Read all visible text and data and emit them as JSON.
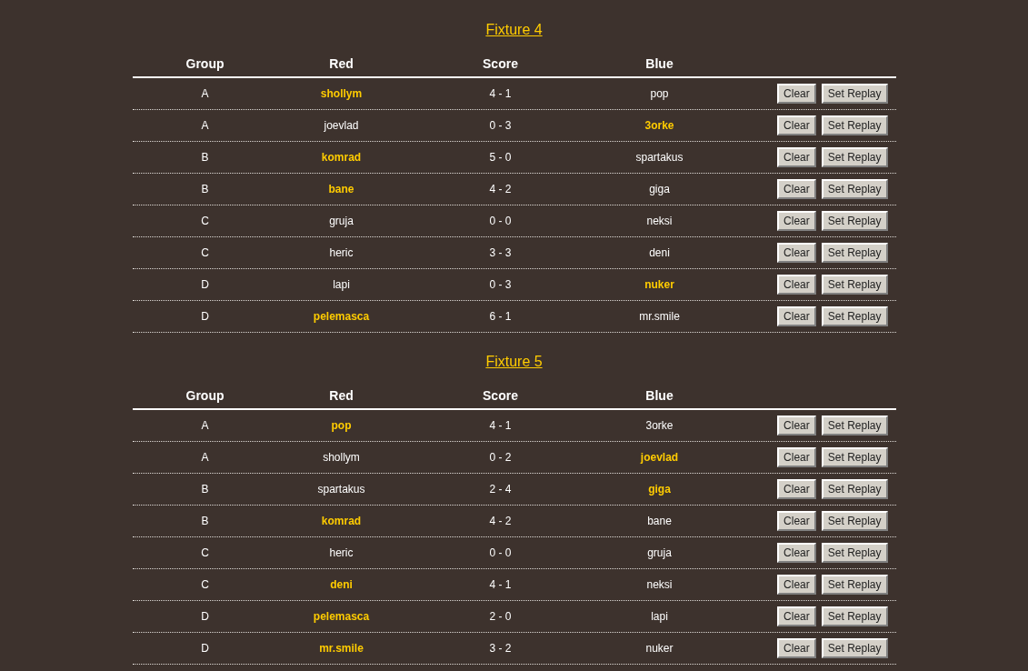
{
  "fixtures": [
    {
      "title": "Fixture 4",
      "columns": [
        "Group",
        "Red",
        "Score",
        "Blue"
      ],
      "rows": [
        {
          "group": "A",
          "red": "shollym",
          "red_highlighted": true,
          "score": "4 - 1",
          "blue": "pop",
          "blue_highlighted": false,
          "buttons": [
            "Clear",
            "Set Replay"
          ]
        },
        {
          "group": "A",
          "red": "joevlad",
          "red_highlighted": false,
          "score": "0 - 3",
          "blue": "3orke",
          "blue_highlighted": true,
          "buttons": [
            "Clear",
            "Set Replay"
          ]
        },
        {
          "group": "B",
          "red": "komrad",
          "red_highlighted": true,
          "score": "5 - 0",
          "blue": "spartakus",
          "blue_highlighted": false,
          "buttons": [
            "Clear",
            "Set Replay"
          ]
        },
        {
          "group": "B",
          "red": "bane",
          "red_highlighted": true,
          "score": "4 - 2",
          "blue": "giga",
          "blue_highlighted": false,
          "buttons": [
            "Clear",
            "Set Replay"
          ]
        },
        {
          "group": "C",
          "red": "gruja",
          "red_highlighted": false,
          "score": "0 - 0",
          "blue": "neksi",
          "blue_highlighted": false,
          "buttons": [
            "Clear",
            "Set Replay"
          ]
        },
        {
          "group": "C",
          "red": "heric",
          "red_highlighted": false,
          "score": "3 - 3",
          "blue": "deni",
          "blue_highlighted": false,
          "buttons": [
            "Clear",
            "Set Replay"
          ]
        },
        {
          "group": "D",
          "red": "lapi",
          "red_highlighted": false,
          "score": "0 - 3",
          "blue": "nuker",
          "blue_highlighted": true,
          "buttons": [
            "Clear",
            "Set Replay"
          ]
        },
        {
          "group": "D",
          "red": "pelemasca",
          "red_highlighted": true,
          "score": "6 - 1",
          "blue": "mr.smile",
          "blue_highlighted": false,
          "buttons": [
            "Clear",
            "Set Replay"
          ]
        }
      ]
    },
    {
      "title": "Fixture 5",
      "columns": [
        "Group",
        "Red",
        "Score",
        "Blue"
      ],
      "rows": [
        {
          "group": "A",
          "red": "pop",
          "red_highlighted": true,
          "score": "4 - 1",
          "blue": "3orke",
          "blue_highlighted": false,
          "buttons": [
            "Clear",
            "Set Replay"
          ]
        },
        {
          "group": "A",
          "red": "shollym",
          "red_highlighted": false,
          "score": "0 - 2",
          "blue": "joevlad",
          "blue_highlighted": true,
          "buttons": [
            "Clear",
            "Set Replay"
          ]
        },
        {
          "group": "B",
          "red": "spartakus",
          "red_highlighted": false,
          "score": "2 - 4",
          "blue": "giga",
          "blue_highlighted": true,
          "buttons": [
            "Clear",
            "Set Replay"
          ]
        },
        {
          "group": "B",
          "red": "komrad",
          "red_highlighted": true,
          "score": "4 - 2",
          "blue": "bane",
          "blue_highlighted": false,
          "buttons": [
            "Clear",
            "Set Replay"
          ]
        },
        {
          "group": "C",
          "red": "heric",
          "red_highlighted": false,
          "score": "0 - 0",
          "blue": "gruja",
          "blue_highlighted": false,
          "buttons": [
            "Clear",
            "Set Replay"
          ]
        },
        {
          "group": "C",
          "red": "deni",
          "red_highlighted": true,
          "score": "4 - 1",
          "blue": "neksi",
          "blue_highlighted": false,
          "buttons": [
            "Clear",
            "Set Replay"
          ]
        },
        {
          "group": "D",
          "red": "pelemasca",
          "red_highlighted": true,
          "score": "2 - 0",
          "blue": "lapi",
          "blue_highlighted": false,
          "buttons": [
            "Clear",
            "Set Replay"
          ]
        },
        {
          "group": "D",
          "red": "mr.smile",
          "red_highlighted": true,
          "score": "3 - 2",
          "blue": "nuker",
          "blue_highlighted": false,
          "buttons": [
            "Clear",
            "Set Replay"
          ]
        }
      ]
    }
  ]
}
